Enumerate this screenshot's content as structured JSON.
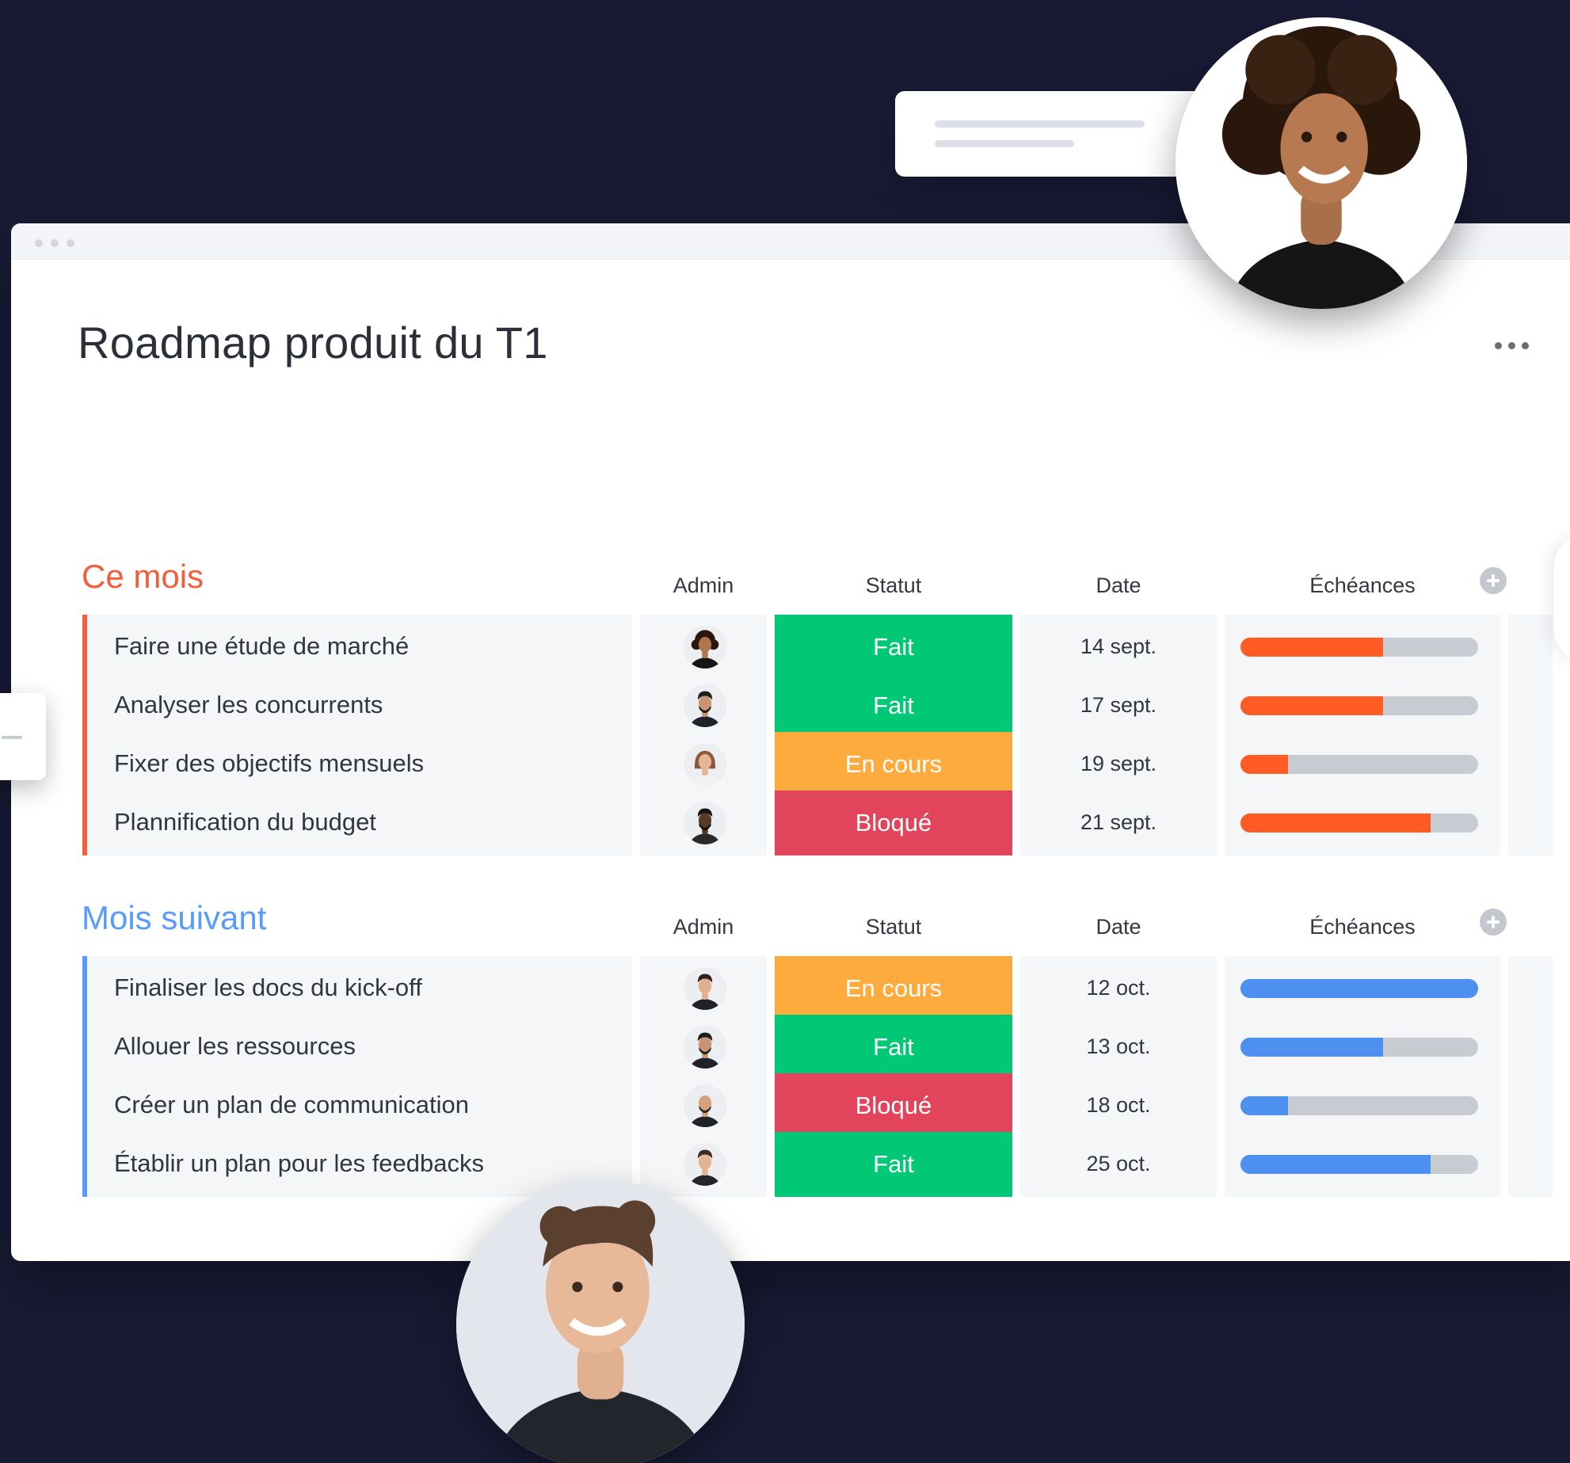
{
  "board": {
    "title": "Roadmap produit du T1"
  },
  "columns": {
    "admin": "Admin",
    "status": "Statut",
    "date": "Date",
    "timeline": "Échéances"
  },
  "colors": {
    "background": "#191b36",
    "done": "#00c875",
    "working": "#fdab3d",
    "stuck": "#e2445c",
    "group_current": "#f0603d",
    "group_next": "#579bfc",
    "timeline_current": "#ff5b24",
    "timeline_next": "#4d90f0",
    "timeline_track": "#c8cbd2"
  },
  "groups": [
    {
      "title": "Ce mois",
      "color": "#f0603d",
      "timeline_color": "#ff5b24",
      "rows": [
        {
          "task": "Faire une étude de marché",
          "admin_icon": "avatar-woman-curly-icon",
          "status": "Fait",
          "status_color": "#00c875",
          "date": "14 sept.",
          "progress": 0.6
        },
        {
          "task": "Analyser les concurrents",
          "admin_icon": "avatar-man-beard-icon",
          "status": "Fait",
          "status_color": "#00c875",
          "date": "17 sept.",
          "progress": 0.6
        },
        {
          "task": "Fixer des objectifs mensuels",
          "admin_icon": "avatar-woman-long-hair-icon",
          "status": "En cours",
          "status_color": "#fdab3d",
          "date": "19 sept.",
          "progress": 0.2
        },
        {
          "task": "Plannification du budget",
          "admin_icon": "avatar-man-dark-icon",
          "status": "Bloqué",
          "status_color": "#e2445c",
          "date": "21 sept.",
          "progress": 0.8
        }
      ]
    },
    {
      "title": "Mois suivant",
      "color": "#579bfc",
      "timeline_color": "#4d90f0",
      "rows": [
        {
          "task": "Finaliser les docs du kick-off",
          "admin_icon": "avatar-man-short-hair-icon",
          "status": "En cours",
          "status_color": "#fdab3d",
          "date": "12 oct.",
          "progress": 1.0
        },
        {
          "task": "Allouer les ressources",
          "admin_icon": "avatar-man-beard-icon",
          "status": "Fait",
          "status_color": "#00c875",
          "date": "13 oct.",
          "progress": 0.6
        },
        {
          "task": "Créer un plan de communication",
          "admin_icon": "avatar-man-bald-icon",
          "status": "Bloqué",
          "status_color": "#e2445c",
          "date": "18 oct.",
          "progress": 0.2
        },
        {
          "task": "Établir un plan pour les feedbacks",
          "admin_icon": "avatar-man-smiling-icon",
          "status": "Fait",
          "status_color": "#00c875",
          "date": "25 oct.",
          "progress": 0.8
        }
      ]
    }
  ]
}
